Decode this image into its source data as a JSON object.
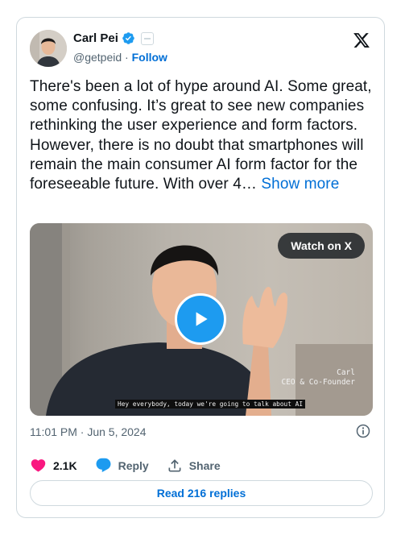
{
  "author": {
    "name": "Carl Pei",
    "handle": "@getpeid",
    "separator": "·",
    "follow_label": "Follow"
  },
  "tweet": {
    "text": "There's been a lot of hype around AI. Some great, some confusing. It’s great to see new companies rethinking the user experience and form factors. However, there is no doubt that smartphones will remain the main consumer AI form factor for the foreseeable future. With over 4…",
    "show_more_label": "Show more"
  },
  "video": {
    "watch_label": "Watch on X",
    "lower_third_name": "Carl",
    "lower_third_title": "CEO & Co-Founder",
    "caption": "Hey everybody, today we're going to talk about AI"
  },
  "meta": {
    "timestamp": "11:01 PM · Jun 5, 2024"
  },
  "actions": {
    "likes": "2.1K",
    "reply_label": "Reply",
    "share_label": "Share"
  },
  "footer": {
    "read_replies_label": "Read 216 replies"
  },
  "icons": {
    "verified": "verified-badge-icon",
    "affiliate": "affiliate-badge-icon",
    "logo": "x-logo-icon",
    "play": "play-icon",
    "info": "info-icon",
    "like": "heart-icon",
    "reply": "chat-bubble-icon",
    "share": "share-upload-icon"
  },
  "colors": {
    "accent": "#1d9bf0",
    "link": "#006fd6",
    "like": "#f91880",
    "text": "#0f1419",
    "muted": "#536471",
    "border": "#cfd9de"
  }
}
